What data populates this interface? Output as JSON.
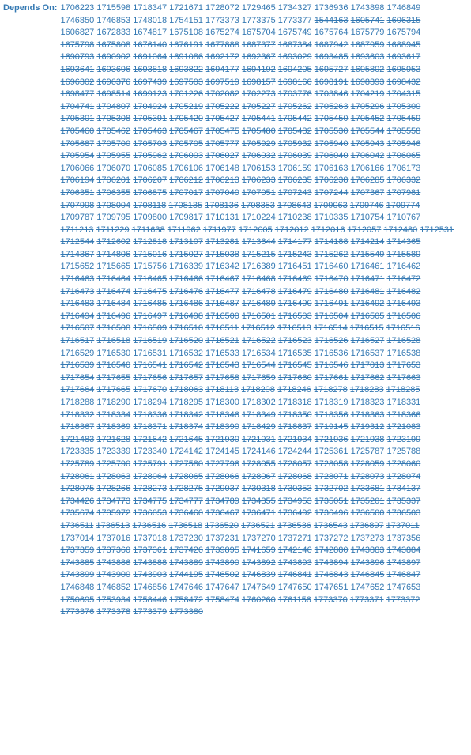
{
  "label": "Depends On:",
  "open": [
    "1706223",
    "1715598",
    "1718347",
    "1721671",
    "1728072",
    "1729465",
    "1734327",
    "1736936",
    "1743898",
    "1746849",
    "1746850",
    "1746853",
    "1748018",
    "1754151",
    "1773373",
    "1773375",
    "1773377"
  ],
  "closed": [
    "1544163",
    "1605741",
    "1606315",
    "1606827",
    "1672833",
    "1674817",
    "1675108",
    "1675274",
    "1675704",
    "1675749",
    "1675764",
    "1675779",
    "1675794",
    "1675798",
    "1675808",
    "1676140",
    "1676191",
    "1677888",
    "1687377",
    "1687384",
    "1687942",
    "1687959",
    "1688945",
    "1690793",
    "1690902",
    "1691064",
    "1691086",
    "1692172",
    "1692367",
    "1693029",
    "1693485",
    "1693603",
    "1693617",
    "1693641",
    "1693696",
    "1693818",
    "1693822",
    "1694177",
    "1694192",
    "1694205",
    "1695727",
    "1695802",
    "1695953",
    "1696302",
    "1696376",
    "1697439",
    "1697503",
    "1697519",
    "1698157",
    "1698160",
    "1698191",
    "1698393",
    "1698432",
    "1698477",
    "1698514",
    "1699123",
    "1701226",
    "1702082",
    "1702273",
    "1703776",
    "1703846",
    "1704219",
    "1704315",
    "1704741",
    "1704807",
    "1704924",
    "1705219",
    "1705222",
    "1705227",
    "1705262",
    "1705263",
    "1705296",
    "1705300",
    "1705301",
    "1705308",
    "1705391",
    "1705420",
    "1705427",
    "1705441",
    "1705442",
    "1705450",
    "1705452",
    "1705459",
    "1705460",
    "1705462",
    "1705463",
    "1705467",
    "1705475",
    "1705480",
    "1705482",
    "1705530",
    "1705544",
    "1705558",
    "1705687",
    "1705700",
    "1705703",
    "1705705",
    "1705777",
    "1705929",
    "1705932",
    "1705940",
    "1705943",
    "1705946",
    "1705954",
    "1705955",
    "1705962",
    "1706003",
    "1706027",
    "1706032",
    "1706039",
    "1706040",
    "1706042",
    "1706065",
    "1706066",
    "1706070",
    "1706085",
    "1706106",
    "1706148",
    "1706153",
    "1706159",
    "1706163",
    "1706166",
    "1706173",
    "1706194",
    "1706201",
    "1706207",
    "1706212",
    "1706213",
    "1706233",
    "1706235",
    "1706238",
    "1706285",
    "1706332",
    "1706351",
    "1706355",
    "1706875",
    "1707017",
    "1707040",
    "1707051",
    "1707243",
    "1707244",
    "1707367",
    "1707981",
    "1707998",
    "1708004",
    "1708118",
    "1708135",
    "1708136",
    "1708353",
    "1708643",
    "1709063",
    "1709746",
    "1709774",
    "1709787",
    "1709795",
    "1709800",
    "1709817",
    "1710131",
    "1710224",
    "1710238",
    "1710335",
    "1710754",
    "1710767",
    "1711213",
    "1711229",
    "1711638",
    "1711962",
    "1711977",
    "1712005",
    "1712012",
    "1712016",
    "1712057",
    "1712480",
    "1712531",
    "1712544",
    "1712602",
    "1712818",
    "1713107",
    "1713281",
    "1713644",
    "1714177",
    "1714188",
    "1714214",
    "1714365",
    "1714367",
    "1714806",
    "1715016",
    "1715027",
    "1715038",
    "1715215",
    "1715243",
    "1715262",
    "1715549",
    "1715589",
    "1715652",
    "1715665",
    "1715756",
    "1716339",
    "1716342",
    "1716389",
    "1716451",
    "1716460",
    "1716461",
    "1716462",
    "1716463",
    "1716464",
    "1716465",
    "1716466",
    "1716467",
    "1716468",
    "1716469",
    "1716470",
    "1716471",
    "1716472",
    "1716473",
    "1716474",
    "1716475",
    "1716476",
    "1716477",
    "1716478",
    "1716479",
    "1716480",
    "1716481",
    "1716482",
    "1716483",
    "1716484",
    "1716485",
    "1716486",
    "1716487",
    "1716489",
    "1716490",
    "1716491",
    "1716492",
    "1716493",
    "1716494",
    "1716496",
    "1716497",
    "1716498",
    "1716500",
    "1716501",
    "1716503",
    "1716504",
    "1716505",
    "1716506",
    "1716507",
    "1716508",
    "1716509",
    "1716510",
    "1716511",
    "1716512",
    "1716513",
    "1716514",
    "1716515",
    "1716516",
    "1716517",
    "1716518",
    "1716519",
    "1716520",
    "1716521",
    "1716522",
    "1716523",
    "1716526",
    "1716527",
    "1716528",
    "1716529",
    "1716530",
    "1716531",
    "1716532",
    "1716533",
    "1716534",
    "1716535",
    "1716536",
    "1716537",
    "1716538",
    "1716539",
    "1716540",
    "1716541",
    "1716542",
    "1716543",
    "1716544",
    "1716545",
    "1716546",
    "1717013",
    "1717653",
    "1717654",
    "1717655",
    "1717656",
    "1717657",
    "1717658",
    "1717659",
    "1717660",
    "1717661",
    "1717662",
    "1717663",
    "1717664",
    "1717665",
    "1717670",
    "1718063",
    "1718113",
    "1718208",
    "1718246",
    "1718278",
    "1718283",
    "1718285",
    "1718288",
    "1718290",
    "1718294",
    "1718295",
    "1718300",
    "1718302",
    "1718318",
    "1718319",
    "1718323",
    "1718331",
    "1718332",
    "1718334",
    "1718336",
    "1718342",
    "1718346",
    "1718349",
    "1718350",
    "1718356",
    "1718363",
    "1718366",
    "1718367",
    "1718369",
    "1718371",
    "1718374",
    "1718390",
    "1718429",
    "1718837",
    "1719145",
    "1719312",
    "1721083",
    "1721483",
    "1721628",
    "1721642",
    "1721645",
    "1721930",
    "1721931",
    "1721934",
    "1721936",
    "1721938",
    "1723199",
    "1723335",
    "1723339",
    "1723340",
    "1724142",
    "1724145",
    "1724146",
    "1724244",
    "1725361",
    "1725787",
    "1725788",
    "1725789",
    "1725790",
    "1725791",
    "1727580",
    "1727796",
    "1728055",
    "1728057",
    "1728058",
    "1728059",
    "1728060",
    "1728061",
    "1728063",
    "1728064",
    "1728065",
    "1728066",
    "1728067",
    "1728068",
    "1728071",
    "1728073",
    "1728074",
    "1728075",
    "1728266",
    "1728273",
    "1728275",
    "1729037",
    "1730318",
    "1730353",
    "1732702",
    "1733681",
    "1734137",
    "1734426",
    "1734773",
    "1734775",
    "1734777",
    "1734789",
    "1734855",
    "1734953",
    "1735051",
    "1735201",
    "1735337",
    "1735674",
    "1735972",
    "1736053",
    "1736460",
    "1736467",
    "1736471",
    "1736492",
    "1736496",
    "1736500",
    "1736503",
    "1736511",
    "1736513",
    "1736516",
    "1736518",
    "1736520",
    "1736521",
    "1736536",
    "1736543",
    "1736897",
    "1737011",
    "1737014",
    "1737016",
    "1737018",
    "1737230",
    "1737231",
    "1737270",
    "1737271",
    "1737272",
    "1737273",
    "1737356",
    "1737359",
    "1737360",
    "1737361",
    "1737426",
    "1739895",
    "1741659",
    "1742146",
    "1742880",
    "1743883",
    "1743884",
    "1743885",
    "1743886",
    "1743888",
    "1743889",
    "1743890",
    "1743892",
    "1743893",
    "1743894",
    "1743896",
    "1743897",
    "1743899",
    "1743900",
    "1743903",
    "1744195",
    "1746502",
    "1746839",
    "1746841",
    "1746843",
    "1746845",
    "1746847",
    "1746848",
    "1746852",
    "1746856",
    "1747646",
    "1747647",
    "1747649",
    "1747650",
    "1747651",
    "1747652",
    "1747653",
    "1750695",
    "1753934",
    "1758446",
    "1758472",
    "1758474",
    "1760260",
    "1761156",
    "1773370",
    "1773371",
    "1773372",
    "1773376",
    "1773378",
    "1773379",
    "1773380"
  ]
}
